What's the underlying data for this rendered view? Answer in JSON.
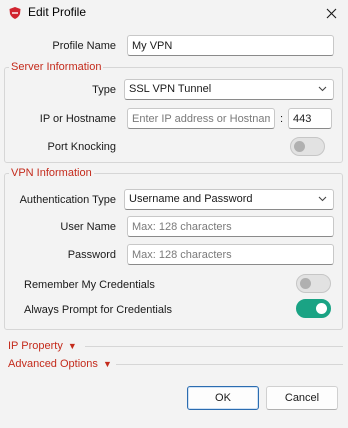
{
  "window": {
    "title": "Edit Profile"
  },
  "profile": {
    "label": "Profile Name",
    "value": "My VPN"
  },
  "server": {
    "group_title": "Server Information",
    "type_label": "Type",
    "type_value": "SSL VPN Tunnel",
    "host_label": "IP or Hostname",
    "host_placeholder": "Enter IP address or Hostname",
    "separator": ":",
    "port_value": "443",
    "port_knocking_label": "Port Knocking",
    "port_knocking_on": false
  },
  "vpn": {
    "group_title": "VPN Information",
    "auth_label": "Authentication Type",
    "auth_value": "Username and Password",
    "user_label": "User Name",
    "user_placeholder": "Max: 128 characters",
    "pass_label": "Password",
    "pass_placeholder": "Max: 128 characters",
    "remember_label": "Remember My Credentials",
    "remember_on": false,
    "prompt_label": "Always Prompt for Credentials",
    "prompt_on": true
  },
  "expanders": {
    "ip_property": "IP Property",
    "advanced_options": "Advanced Options",
    "arrow": "▼"
  },
  "buttons": {
    "ok": "OK",
    "cancel": "Cancel"
  },
  "colors": {
    "accent_red": "#c42b1c",
    "toggle_on": "#1aa384",
    "primary_border": "#2b6cb0"
  },
  "icons": {
    "app": "forticlient-shield-icon",
    "close": "close-icon",
    "dropdown": "chevron-down-icon"
  }
}
